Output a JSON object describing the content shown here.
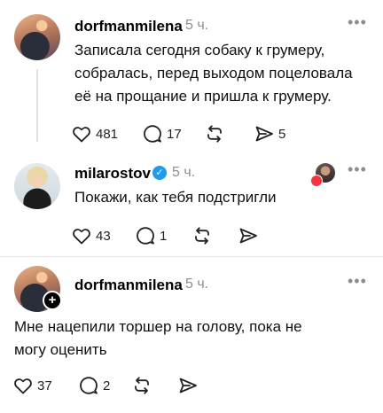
{
  "posts": [
    {
      "username": "dorfmanmilena",
      "time": "5 ч.",
      "text_lines": [
        "Записала сегодня собаку к грумеру,",
        "собралась, перед выходом поцеловала",
        "её на прощание и пришла к грумеру."
      ],
      "likes": "481",
      "comments": "17",
      "reposts": "",
      "shares": "5"
    },
    {
      "username": "milarostov",
      "verified": true,
      "time": "5 ч.",
      "text_lines": [
        "Покажи, как тебя подстригли"
      ],
      "likes": "43",
      "comments": "1",
      "reposts": "",
      "shares": ""
    },
    {
      "username": "dorfmanmilena",
      "time": "5 ч.",
      "text_lines": [
        "Мне нацепили торшер на голову, пока не",
        "могу оценить"
      ],
      "likes": "37",
      "comments": "2",
      "reposts": "",
      "shares": ""
    }
  ],
  "more_glyph": "•••",
  "verified_glyph": "✓",
  "follow_glyph": "+"
}
